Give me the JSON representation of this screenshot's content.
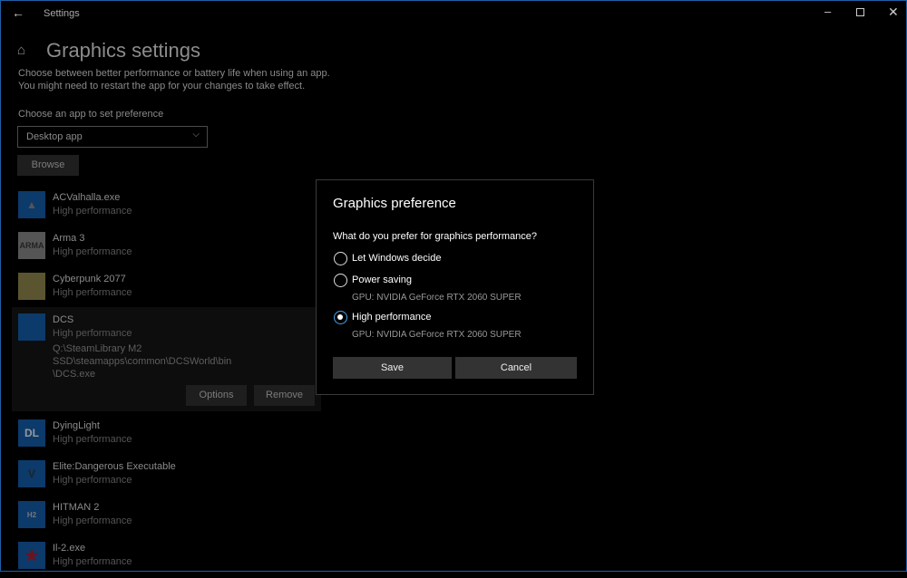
{
  "window": {
    "title": "Settings"
  },
  "page": {
    "title": "Graphics settings",
    "description_lines": [
      "Choose between better performance or battery life when using an app.",
      "You might need to restart the app for your changes to take effect."
    ],
    "choose_label": "Choose an app to set preference",
    "app_type": "Desktop app",
    "browse": "Browse"
  },
  "apps": [
    {
      "name": "ACValhalla.exe",
      "status": "High performance"
    },
    {
      "name": "Arma 3",
      "status": "High performance"
    },
    {
      "name": "Cyberpunk 2077",
      "status": "High performance"
    },
    {
      "name": "DCS",
      "status": "High performance",
      "path_lines": [
        "Q:\\SteamLibrary M2 SSD\\steamapps\\common\\DCSWorld\\bin",
        "\\DCS.exe"
      ],
      "options": "Options",
      "remove": "Remove"
    },
    {
      "name": "DyingLight",
      "status": "High performance"
    },
    {
      "name": "Elite:Dangerous Executable",
      "status": "High performance"
    },
    {
      "name": "HITMAN 2",
      "status": "High performance"
    },
    {
      "name": "Il-2.exe",
      "status": "High performance"
    }
  ],
  "dialog": {
    "title": "Graphics preference",
    "question": "What do you prefer for graphics performance?",
    "options": [
      {
        "label": "Let Windows decide",
        "selected": false
      },
      {
        "label": "Power saving",
        "gpu": "GPU: NVIDIA GeForce RTX 2060 SUPER",
        "selected": false
      },
      {
        "label": "High performance",
        "gpu": "GPU: NVIDIA GeForce RTX 2060 SUPER",
        "selected": true
      }
    ],
    "save": "Save",
    "cancel": "Cancel"
  },
  "colors": {
    "accent": "#4aa0e6",
    "border": "#1f5fa8"
  }
}
